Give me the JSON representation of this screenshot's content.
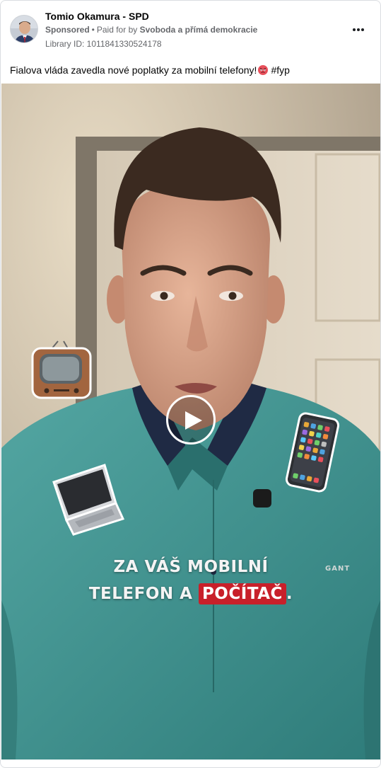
{
  "post": {
    "author": "Tomio Okamura - SPD",
    "sponsored_label": "Sponsored",
    "paid_for_prefix": "Paid for by",
    "paid_for_by": "Svoboda a přímá demokracie",
    "library_id": "Library ID: 1011841330524178",
    "caption_text": "Fialova vláda zavedla nové poplatky za mobilní telefony!",
    "caption_hashtag": "#fyp",
    "caption_emoji": "angry-face-icon",
    "more_icon": "more-options-icon"
  },
  "video": {
    "overlay_line1": "ZA VÁŠ MOBILNÍ",
    "overlay_line2_prefix": "TELEFON A",
    "overlay_line2_highlight": "POČÍTAČ",
    "overlay_line2_suffix": ".",
    "shirt_logo": "GANT",
    "stickers": [
      "television-icon",
      "laptop-icon",
      "mobile-phone-icon"
    ],
    "play_icon": "play-icon"
  },
  "colors": {
    "highlight": "#c8202a",
    "shirt": "#4a9a97",
    "meta_text": "#65676b",
    "border": "#dadde1"
  }
}
